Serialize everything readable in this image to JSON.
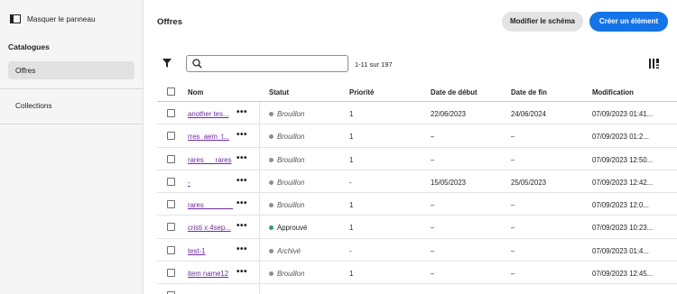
{
  "sidebar": {
    "hide_panel_label": "Masquer le panneau",
    "catalog_title": "Catalogues",
    "items": [
      {
        "label": "Offres",
        "active": true
      },
      {
        "label": "Collections",
        "active": false
      }
    ]
  },
  "header": {
    "title": "Offres",
    "edit_schema_label": "Modifier le schéma",
    "create_label": "Créer un élément"
  },
  "toolbar": {
    "search_value": "",
    "count_label": "1-11 sur 197"
  },
  "colors": {
    "accent": "#1473e6",
    "link": "#6e2a9e",
    "status_draft": "#8e8e8e",
    "status_approved": "#2d9d78",
    "status_archived": "#8e8e8e"
  },
  "table": {
    "columns": [
      "Nom",
      "Statut",
      "Priorité",
      "Date de début",
      "Date de fin",
      "Modification"
    ],
    "rows": [
      {
        "name": "another tes...",
        "status": "Brouillon",
        "status_kind": "draft",
        "priority": "1",
        "start": "22/06/2023",
        "end": "24/06/2024",
        "modified": "07/09/2023 01:41..."
      },
      {
        "name": "rres_aem_t...",
        "status": "Brouillon",
        "status_kind": "draft",
        "priority": "1",
        "start": "–",
        "end": "–",
        "modified": "07/09/2023 01:2..."
      },
      {
        "name": "rares___rares",
        "status": "Brouillon",
        "status_kind": "draft",
        "priority": "1",
        "start": "–",
        "end": "–",
        "modified": "07/09/2023 12:50..."
      },
      {
        "name": "-",
        "status": "Brouillon",
        "status_kind": "draft",
        "priority": "-",
        "start": "15/05/2023",
        "end": "25/05/2023",
        "modified": "07/09/2023 12:42..."
      },
      {
        "name": "rares________...",
        "status": "Brouillon",
        "status_kind": "draft",
        "priority": "1",
        "start": "–",
        "end": "–",
        "modified": "07/09/2023 12:0..."
      },
      {
        "name": "cristi x 4sep...",
        "status": "Approuvé",
        "status_kind": "approved",
        "priority": "1",
        "start": "–",
        "end": "–",
        "modified": "07/09/2023 10:23..."
      },
      {
        "name": "test-1",
        "status": "Archivé",
        "status_kind": "archived",
        "priority": "-",
        "start": "–",
        "end": "–",
        "modified": "07/09/2023 01:4..."
      },
      {
        "name": "item name12",
        "status": "Brouillon",
        "status_kind": "draft",
        "priority": "1",
        "start": "–",
        "end": "–",
        "modified": "07/09/2023 12:45..."
      }
    ]
  }
}
